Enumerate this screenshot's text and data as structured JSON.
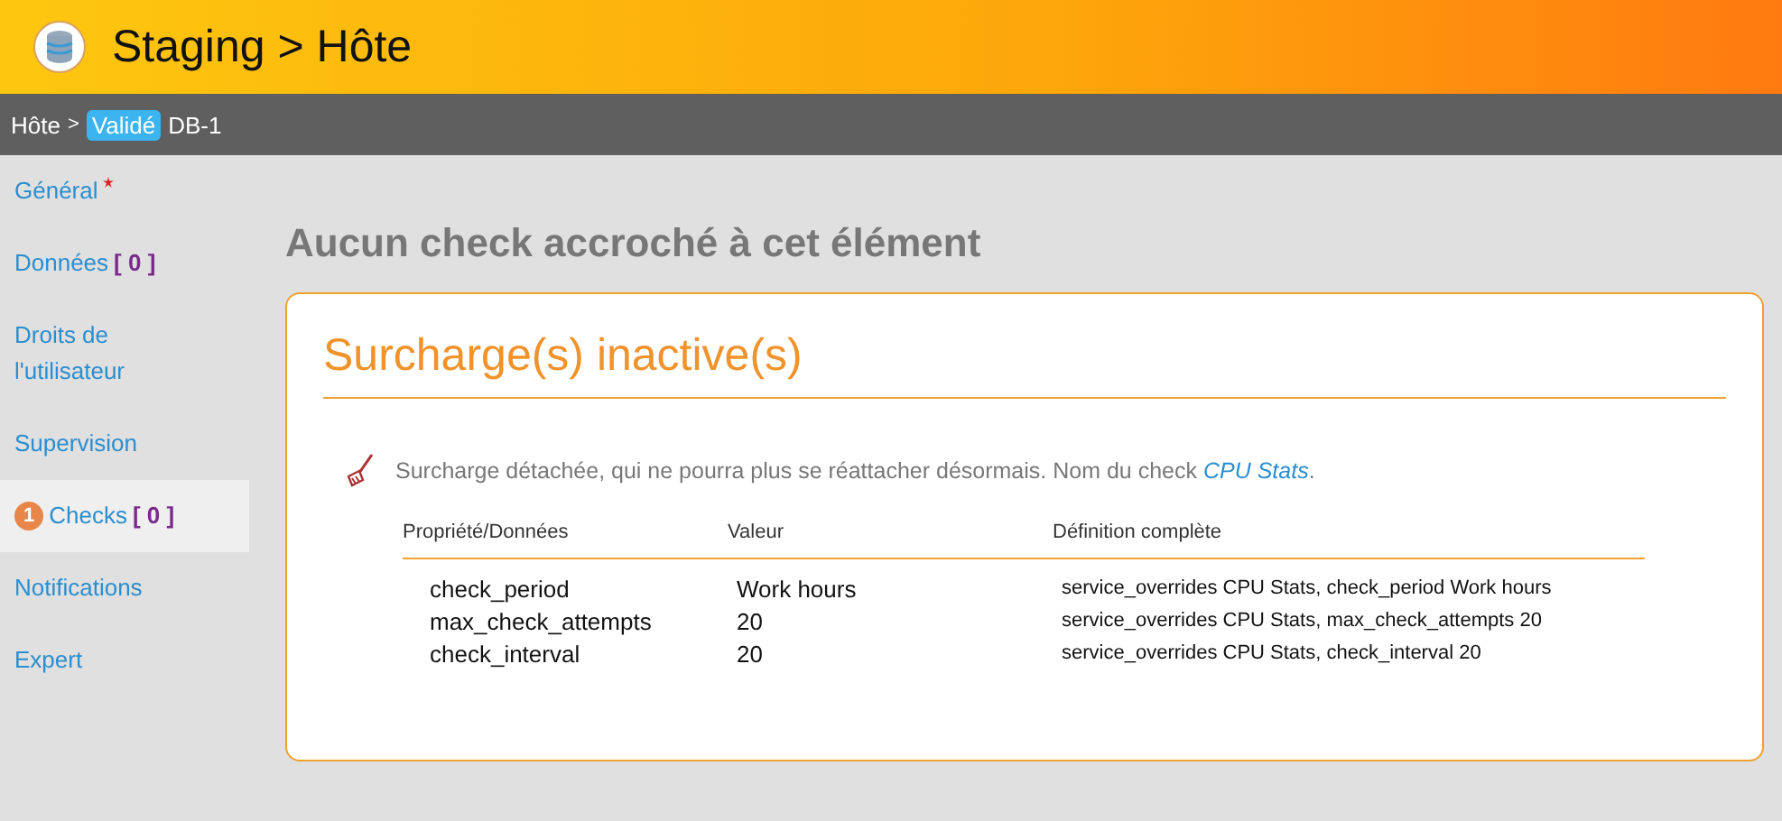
{
  "header": {
    "title": "Staging > Hôte"
  },
  "breadcrumb": {
    "parent": "Hôte",
    "separator": ">",
    "status": "Validé",
    "current": "DB-1"
  },
  "sidebar": {
    "items": [
      {
        "label": "Général",
        "required": true,
        "selected": false
      },
      {
        "label": "Données",
        "count": "[ 0 ]",
        "selected": false
      },
      {
        "label": "Droits de l'utilisateur",
        "selected": false
      },
      {
        "label": "Supervision",
        "selected": false
      },
      {
        "label": "Checks",
        "count": "[ 0 ]",
        "badge": "1",
        "selected": true
      },
      {
        "label": "Notifications",
        "selected": false
      },
      {
        "label": "Expert",
        "selected": false
      }
    ]
  },
  "heading": "Aucun check accroché à cet élément",
  "card": {
    "title": "Surcharge(s) inactive(s)",
    "notice": {
      "text": "Surcharge détachée, qui ne pourra plus se réattacher désormais. Nom du check",
      "link": "CPU Stats",
      "suffix": "."
    },
    "table": {
      "columns": [
        "Propriété/Données",
        "Valeur",
        "Définition complète"
      ],
      "rows": [
        {
          "property": "check_period",
          "value": "Work hours",
          "definition": "service_overrides  CPU Stats, check_period Work hours"
        },
        {
          "property": "max_check_attempts",
          "value": "20",
          "definition": "service_overrides  CPU Stats, max_check_attempts 20"
        },
        {
          "property": "check_interval",
          "value": "20",
          "definition": "service_overrides  CPU Stats, check_interval 20"
        }
      ]
    }
  }
}
